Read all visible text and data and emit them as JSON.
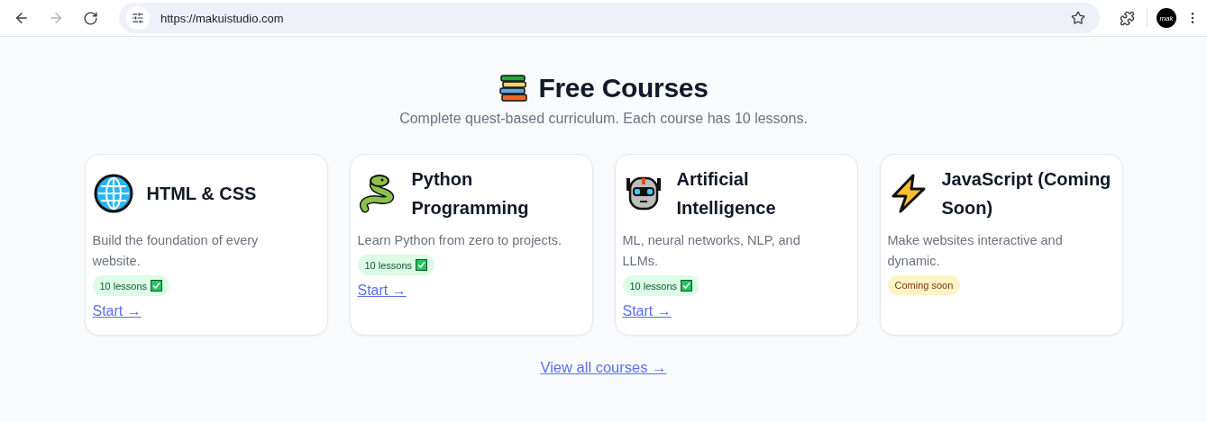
{
  "browser": {
    "url": "https://makuistudio.com",
    "forward_disabled": true,
    "avatar": "mak"
  },
  "header": {
    "title": "Free Courses",
    "subtitle": "Complete quest-based curriculum. Each course has 10 lessons."
  },
  "courses": [
    {
      "title": "HTML & CSS",
      "description": "Build the foundation of every website.",
      "badge": {
        "text": "10 lessons",
        "kind": "ready"
      },
      "link": "Start →"
    },
    {
      "title": "Python Programming",
      "description": "Learn Python from zero to projects.",
      "badge": {
        "text": "10 lessons",
        "kind": "ready"
      },
      "link": "Start →"
    },
    {
      "title": "Artificial Intelligence",
      "description": "ML, neural networks, NLP, and LLMs.",
      "badge": {
        "text": "10 lessons",
        "kind": "ready"
      },
      "link": "Start →"
    },
    {
      "title": "JavaScript (Coming Soon)",
      "description": "Make websites interactive and dynamic.",
      "badge": {
        "text": "Coming soon",
        "kind": "soon"
      }
    }
  ],
  "footer_link": "View all courses →"
}
